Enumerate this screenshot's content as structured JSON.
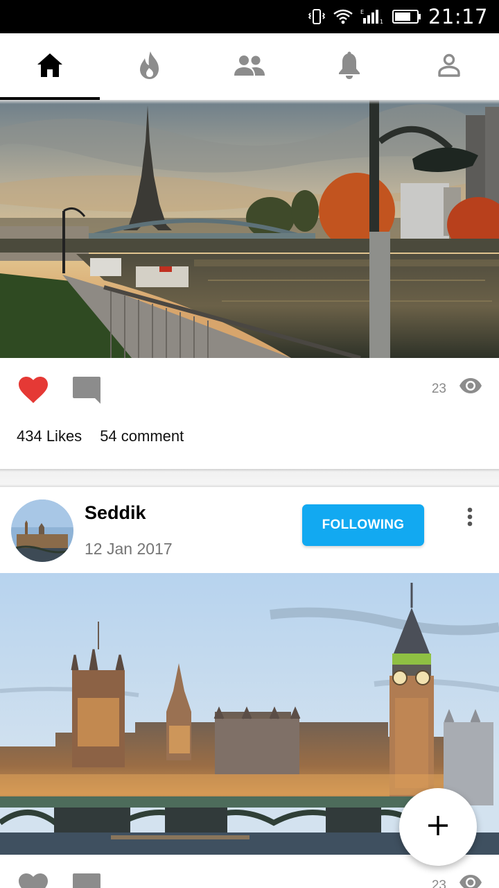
{
  "status_bar": {
    "time": "21:17",
    "icons": [
      "vibrate-icon",
      "wifi-icon",
      "signal-icon",
      "battery-icon"
    ]
  },
  "tabs": [
    {
      "id": "home",
      "icon": "home-icon",
      "active": true
    },
    {
      "id": "trending",
      "icon": "flame-icon",
      "active": false
    },
    {
      "id": "people",
      "icon": "group-icon",
      "active": false
    },
    {
      "id": "notifications",
      "icon": "bell-icon",
      "active": false
    },
    {
      "id": "profile",
      "icon": "person-icon",
      "active": false
    }
  ],
  "posts": [
    {
      "image": "eiffel-tower-river-photo",
      "liked": true,
      "views": "23",
      "likes_label": "434 Likes",
      "comments_label": "54 comment"
    },
    {
      "author": "Seddik",
      "date": "12 Jan 2017",
      "follow_label": "FOLLOWING",
      "image": "big-ben-parliament-photo",
      "liked": false,
      "views": "23"
    }
  ],
  "fab": {
    "icon": "plus-icon"
  },
  "colors": {
    "accent": "#12a9f1",
    "like": "#e53935",
    "icon_gray": "#8c8c8c",
    "active_tab": "#000000"
  }
}
